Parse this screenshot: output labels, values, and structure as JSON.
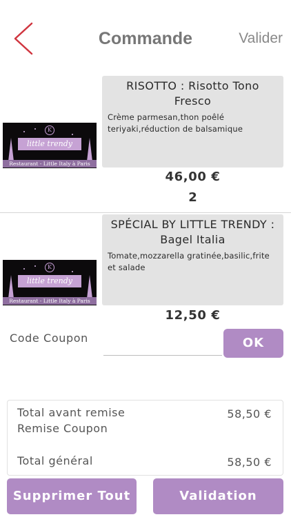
{
  "header": {
    "title": "Commande",
    "validate_label": "Valider",
    "back_icon": "chevron-left-icon",
    "accent_color": "#d0353f"
  },
  "logo": {
    "crest": "K",
    "banner": "little trendy",
    "tagline": "Restaurant - Little Italy à Paris"
  },
  "items": [
    {
      "name": "RISOTTO : Risotto Tono Fresco",
      "description": "Crème parmesan,thon poêlé teriyaki,réduction de balsamique",
      "price": "46,00 €",
      "quantity": "2"
    },
    {
      "name": "SPÉCIAL BY LITTLE TRENDY : Bagel Italia",
      "description": "Tomate,mozzarella gratinée,basilic,frite et salade",
      "price": "12,50 €"
    }
  ],
  "coupon": {
    "label": "Code Coupon",
    "input_value": "",
    "ok_label": "OK"
  },
  "totals": {
    "before_discount_label": "Total avant remise",
    "before_discount_value": "58,50 €",
    "coupon_discount_label": "Remise Coupon",
    "grand_total_label": "Total général",
    "grand_total_value": "58,50 €"
  },
  "actions": {
    "delete_all_label": "Supprimer Tout",
    "validation_label": "Validation"
  },
  "colors": {
    "button": "#b08bc4",
    "card": "#e3e3e3"
  }
}
